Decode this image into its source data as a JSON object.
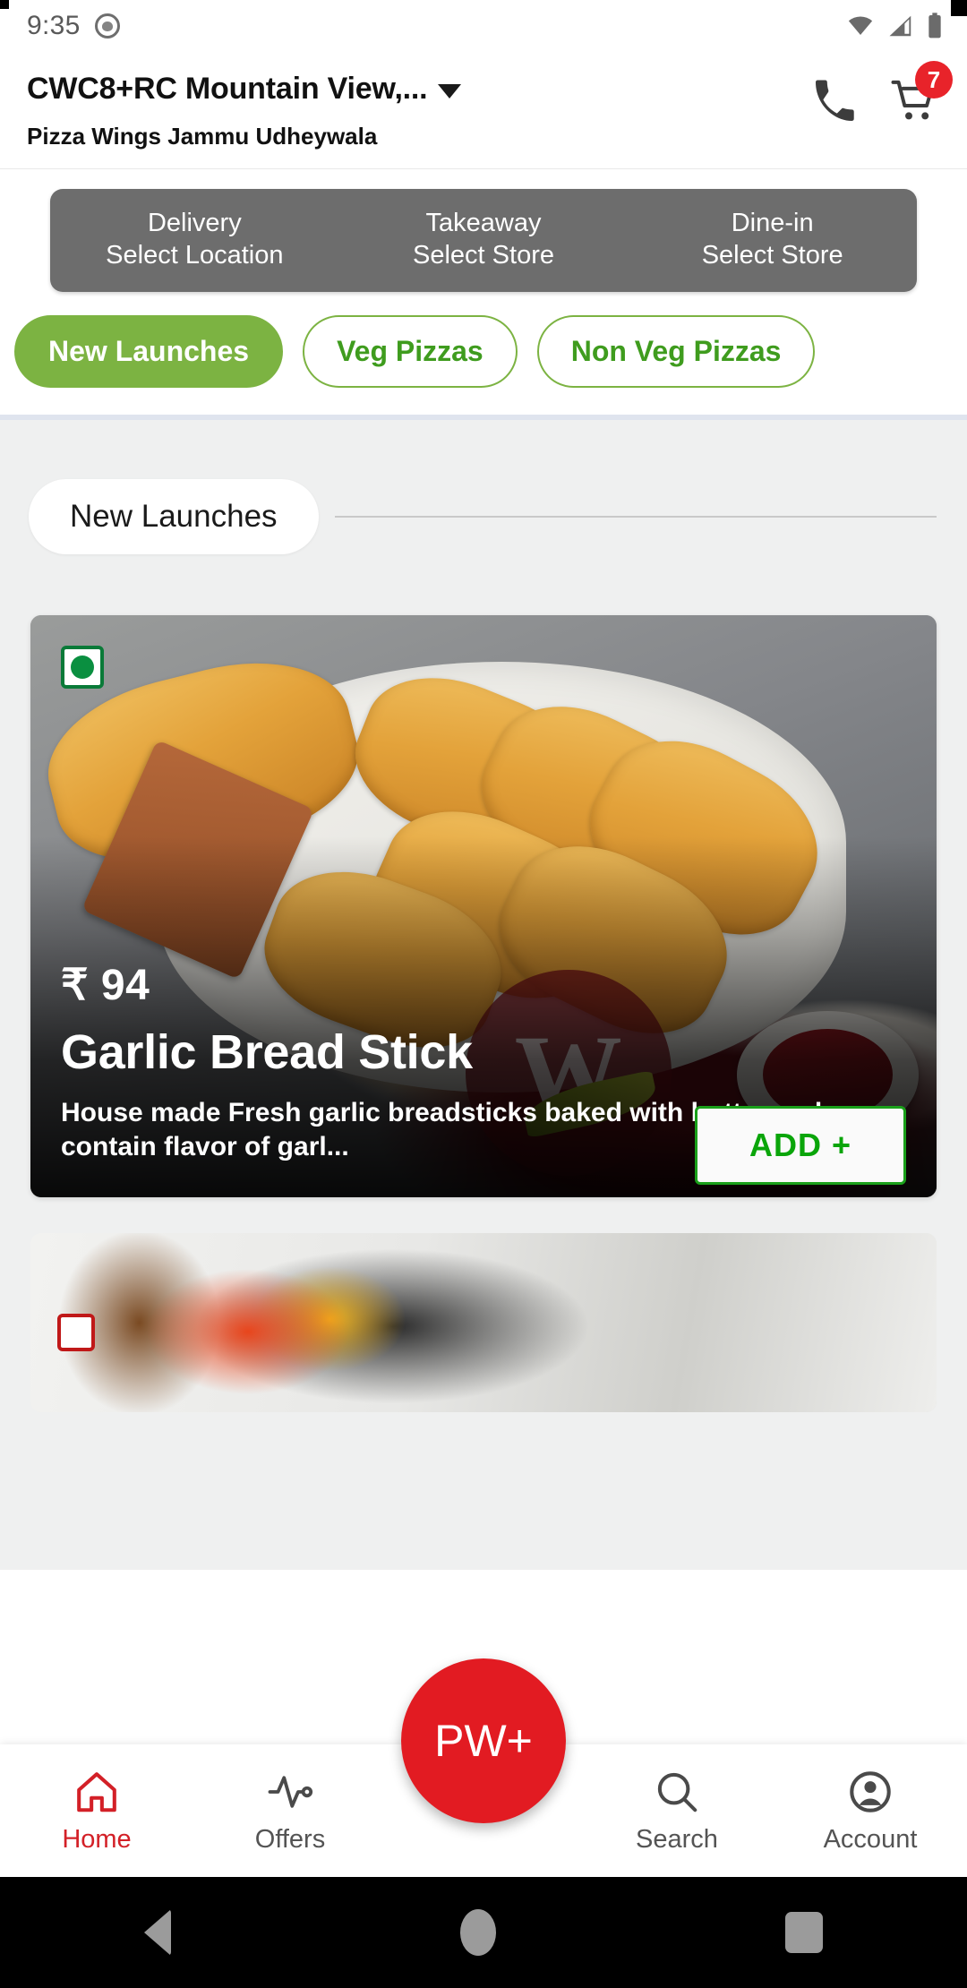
{
  "status_bar": {
    "time": "9:35",
    "icons": [
      "face-icon",
      "wifi-icon",
      "signal-icon",
      "battery-icon"
    ]
  },
  "header": {
    "location": "CWC8+RC Mountain View,...",
    "store_name": "Pizza Wings Jammu Udheywala",
    "call_icon": "phone-icon",
    "cart_icon": "cart-icon",
    "cart_count": "7"
  },
  "order_types": [
    {
      "title": "Delivery",
      "subtitle": "Select Location"
    },
    {
      "title": "Takeaway",
      "subtitle": "Select Store"
    },
    {
      "title": "Dine-in",
      "subtitle": "Select Store"
    }
  ],
  "categories": [
    {
      "label": "New Launches",
      "active": true
    },
    {
      "label": "Veg Pizzas",
      "active": false
    },
    {
      "label": "Non Veg Pizzas",
      "active": false
    }
  ],
  "section": {
    "title": "New Launches"
  },
  "product": {
    "price": "₹ 94",
    "name": "Garlic Bread Stick",
    "description": "House made Fresh garlic breadsticks baked with butter and contain flavor of garl...",
    "add_label": "ADD +",
    "diet": "veg",
    "watermark": "W"
  },
  "bottom_nav": {
    "items": [
      {
        "label": "Home",
        "icon": "home-icon",
        "active": true
      },
      {
        "label": "Offers",
        "icon": "pulse-icon",
        "active": false
      },
      {
        "label": "Search",
        "icon": "search-icon",
        "active": false
      },
      {
        "label": "Account",
        "icon": "account-icon",
        "active": false
      }
    ],
    "fab_label": "PW+"
  },
  "colors": {
    "accent_green": "#7cb342",
    "brand_red": "#e21b22",
    "add_green": "#0aa50a",
    "ordertype_grey": "#6d6d6d",
    "page_bg": "#eff0f0"
  }
}
